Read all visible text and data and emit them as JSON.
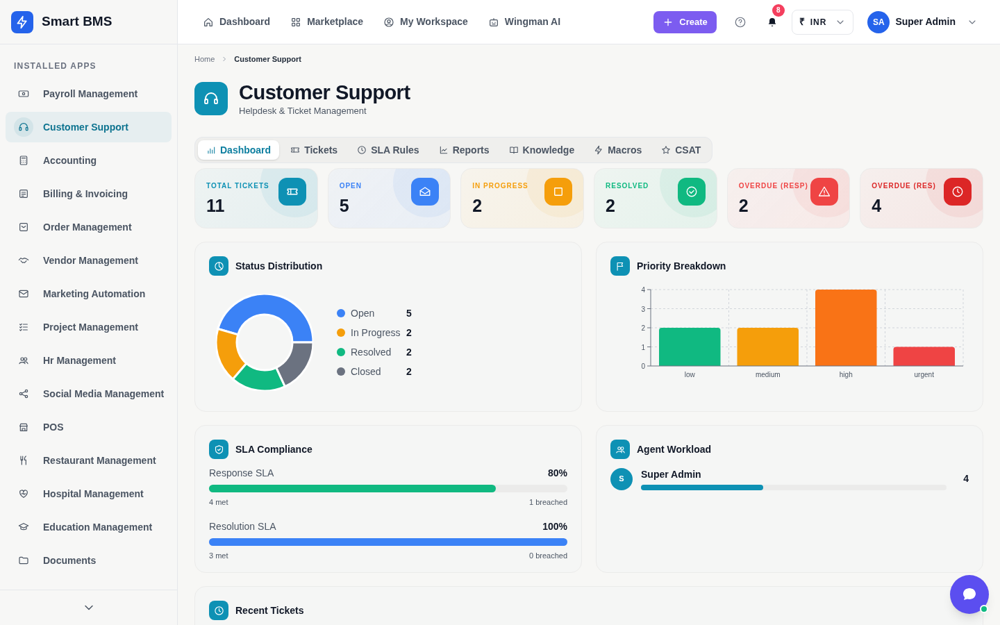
{
  "brand": {
    "name": "Smart BMS"
  },
  "topnav": [
    {
      "label": "Dashboard"
    },
    {
      "label": "Marketplace"
    },
    {
      "label": "My Workspace"
    },
    {
      "label": "Wingman AI"
    }
  ],
  "create_button": "Create",
  "notifications": {
    "count": "8"
  },
  "currency": {
    "symbol": "₹",
    "code": "INR"
  },
  "user": {
    "initials": "SA",
    "name": "Super Admin"
  },
  "sidebar": {
    "heading": "INSTALLED APPS",
    "items": [
      {
        "label": "Payroll Management",
        "selected": false
      },
      {
        "label": "Customer Support",
        "selected": true
      },
      {
        "label": "Accounting",
        "selected": false
      },
      {
        "label": "Billing & Invoicing",
        "selected": false
      },
      {
        "label": "Order Management",
        "selected": false
      },
      {
        "label": "Vendor Management",
        "selected": false
      },
      {
        "label": "Marketing Automation",
        "selected": false
      },
      {
        "label": "Project Management",
        "selected": false
      },
      {
        "label": "Hr Management",
        "selected": false
      },
      {
        "label": "Social Media Management",
        "selected": false
      },
      {
        "label": "POS",
        "selected": false
      },
      {
        "label": "Restaurant Management",
        "selected": false
      },
      {
        "label": "Hospital Management",
        "selected": false
      },
      {
        "label": "Education Management",
        "selected": false
      },
      {
        "label": "Documents",
        "selected": false
      }
    ]
  },
  "breadcrumb": [
    "Home",
    "Customer Support"
  ],
  "page": {
    "title": "Customer Support",
    "subtitle": "Helpdesk & Ticket Management"
  },
  "tabs": [
    {
      "label": "Dashboard",
      "selected": true
    },
    {
      "label": "Tickets",
      "selected": false
    },
    {
      "label": "SLA Rules",
      "selected": false
    },
    {
      "label": "Reports",
      "selected": false
    },
    {
      "label": "Knowledge",
      "selected": false
    },
    {
      "label": "Macros",
      "selected": false
    },
    {
      "label": "CSAT",
      "selected": false
    }
  ],
  "stats": [
    {
      "label": "TOTAL TICKETS",
      "value": "11",
      "color": "#0e91b4"
    },
    {
      "label": "OPEN",
      "value": "5",
      "color": "#3b82f6"
    },
    {
      "label": "IN PROGRESS",
      "value": "2",
      "color": "#f59e0b"
    },
    {
      "label": "RESOLVED",
      "value": "2",
      "color": "#10b981"
    },
    {
      "label": "OVERDUE (RESP)",
      "value": "2",
      "color": "#ef4444"
    },
    {
      "label": "OVERDUE (RES)",
      "value": "4",
      "color": "#dc2626"
    }
  ],
  "status_distribution": {
    "title": "Status Distribution",
    "chart_data": {
      "type": "donut",
      "categories": [
        "Open",
        "In Progress",
        "Resolved",
        "Closed"
      ],
      "values": [
        45.5,
        18.2,
        18.2,
        18.1
      ]
    },
    "legend": [
      {
        "count": "5",
        "color": "#3b82f6"
      },
      {
        "count": "2",
        "color": "#f59e0b"
      },
      {
        "count": "2",
        "color": "#10b981"
      },
      {
        "count": "2",
        "color": "#6b7280"
      }
    ]
  },
  "priority_breakdown": {
    "title": "Priority Breakdown",
    "chart_data": {
      "type": "bar",
      "categories": [
        "low",
        "medium",
        "high",
        "urgent"
      ],
      "values": [
        2,
        2,
        4,
        1
      ],
      "ylim": [
        0,
        4
      ],
      "yticks": [
        0,
        1,
        2,
        3,
        4
      ],
      "grid": true
    }
  },
  "sla": {
    "title": "SLA Compliance",
    "items": [
      {
        "label": "Response SLA",
        "percent": "80%",
        "level": 0.8,
        "met": "4 met",
        "breached": "1 breached",
        "color": "#10b981"
      },
      {
        "label": "Resolution SLA",
        "percent": "100%",
        "level": 1,
        "met": "3 met",
        "breached": "0 breached",
        "color": "#3b82f6"
      }
    ]
  },
  "agent_workload": {
    "title": "Agent Workload",
    "agents": [
      {
        "initial": "S",
        "name": "Super Admin",
        "count": "4",
        "level": 0.4
      }
    ]
  },
  "recent_tickets": {
    "title": "Recent Tickets"
  }
}
